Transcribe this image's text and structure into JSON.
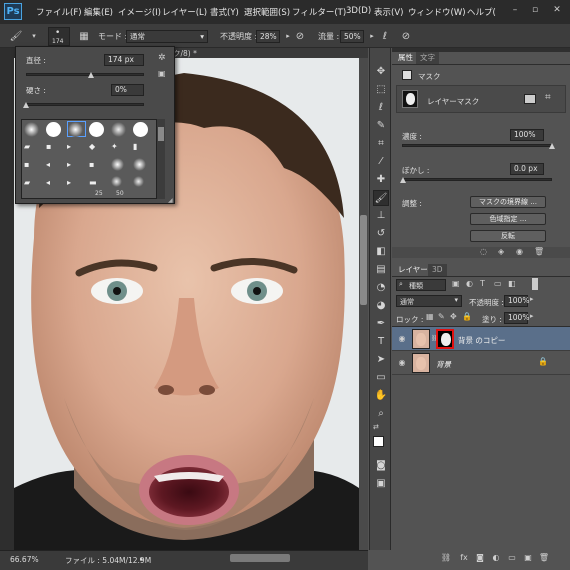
{
  "app": {
    "logo": "Ps",
    "menus": [
      "ファイル(F)",
      "編集(E)",
      "イメージ(I)",
      "レイヤー(L)",
      "書式(Y)",
      "選択範囲(S)",
      "フィルター(T)",
      "3D(D)",
      "表示(V)",
      "ウィンドウ(W)",
      "ヘルプ("
    ]
  },
  "options": {
    "mode_label": "モード :",
    "mode_value": "通常",
    "opacity_label": "不透明度 :",
    "opacity_value": "28%",
    "flow_label": "流量 :",
    "flow_value": "50%",
    "brush_size_badge": "174"
  },
  "document": {
    "tab_title": "ク/8) *",
    "zoom": "66.67%",
    "file_info": "ファイル : 5.04M/12.9M"
  },
  "brush_popup": {
    "size_label": "直径 :",
    "size_value": "174 px",
    "hardness_label": "硬さ :",
    "hardness_value": "0%",
    "size_fraction": 0.55,
    "hardness_fraction": 0.0,
    "brush_numbers": [
      "25",
      "50"
    ]
  },
  "properties": {
    "tabs": [
      "属性",
      "文字"
    ],
    "section_title": "マスク",
    "mask_type": "レイヤーマスク",
    "density_label": "濃度 :",
    "density_value": "100%",
    "feather_label": "ぼかし :",
    "feather_value": "0.0 px",
    "adjust_label": "調整 :",
    "buttons": [
      "マスクの境界線 ...",
      "色域指定 ...",
      "反転"
    ]
  },
  "layers": {
    "tabs": [
      "レイヤー",
      "3D"
    ],
    "filter_value": "種類",
    "blend_value": "通常",
    "opacity_label": "不透明度 :",
    "opacity_value": "100%",
    "lock_label": "ロック :",
    "fill_label": "塗り :",
    "fill_value": "100%",
    "items": [
      {
        "name": "背景 のコピー",
        "selected": true
      },
      {
        "name": "背景",
        "selected": false
      }
    ]
  },
  "colors": {
    "accent_selected": "#5a6f8a",
    "mask_highlight": "#e01010"
  }
}
